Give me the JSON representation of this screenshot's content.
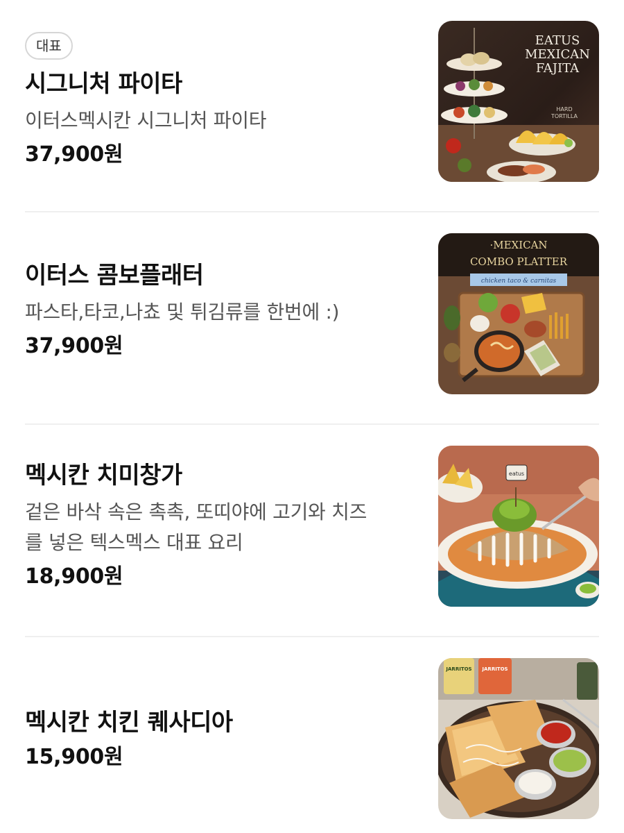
{
  "menu": {
    "items": [
      {
        "badge": "대표",
        "name": "시그니처 파이타",
        "description_lines": [
          "이터스멕시칸 시그니처 파이타"
        ],
        "price": "37,900원",
        "image": {
          "subject": "fajita tower platter photo",
          "overlay_text": [
            "EATUS",
            "MEXICAN",
            "FAJITA"
          ],
          "small_text": [
            "HARD",
            "TORTILLA"
          ]
        }
      },
      {
        "badge": "",
        "name": "이터스 콤보플래터",
        "description_lines": [
          "파스타,타코,나쵸 및 튀김류를 한번에 :)"
        ],
        "price": "37,900원",
        "image": {
          "subject": "combo platter board photo",
          "overlay_text": [
            "·MEXICAN",
            "COMBO PLATTER"
          ],
          "small_text": [
            "chicken taco & carnitas"
          ]
        }
      },
      {
        "badge": "",
        "name": "멕시칸 치미창가",
        "description_lines": [
          "겉은 바삭 속은 촉촉, 또띠야에 고기와 치즈",
          "를 넣은 텍스멕스 대표 요리"
        ],
        "price": "18,900원",
        "image": {
          "subject": "chimichanga plate photo",
          "overlay_text": [],
          "small_text": [
            "eatus"
          ]
        }
      },
      {
        "badge": "",
        "name": "멕시칸 치킨 퀘사디아",
        "description_lines": [],
        "price": "15,900원",
        "image": {
          "subject": "chicken quesadilla plate photo",
          "overlay_text": [],
          "small_text": [
            "JARRITOS",
            "JARRITOS"
          ]
        }
      }
    ]
  },
  "colors": {
    "text_primary": "#111111",
    "text_secondary": "#555555",
    "badge_border": "#d6d6d6",
    "divider": "#efefef"
  }
}
